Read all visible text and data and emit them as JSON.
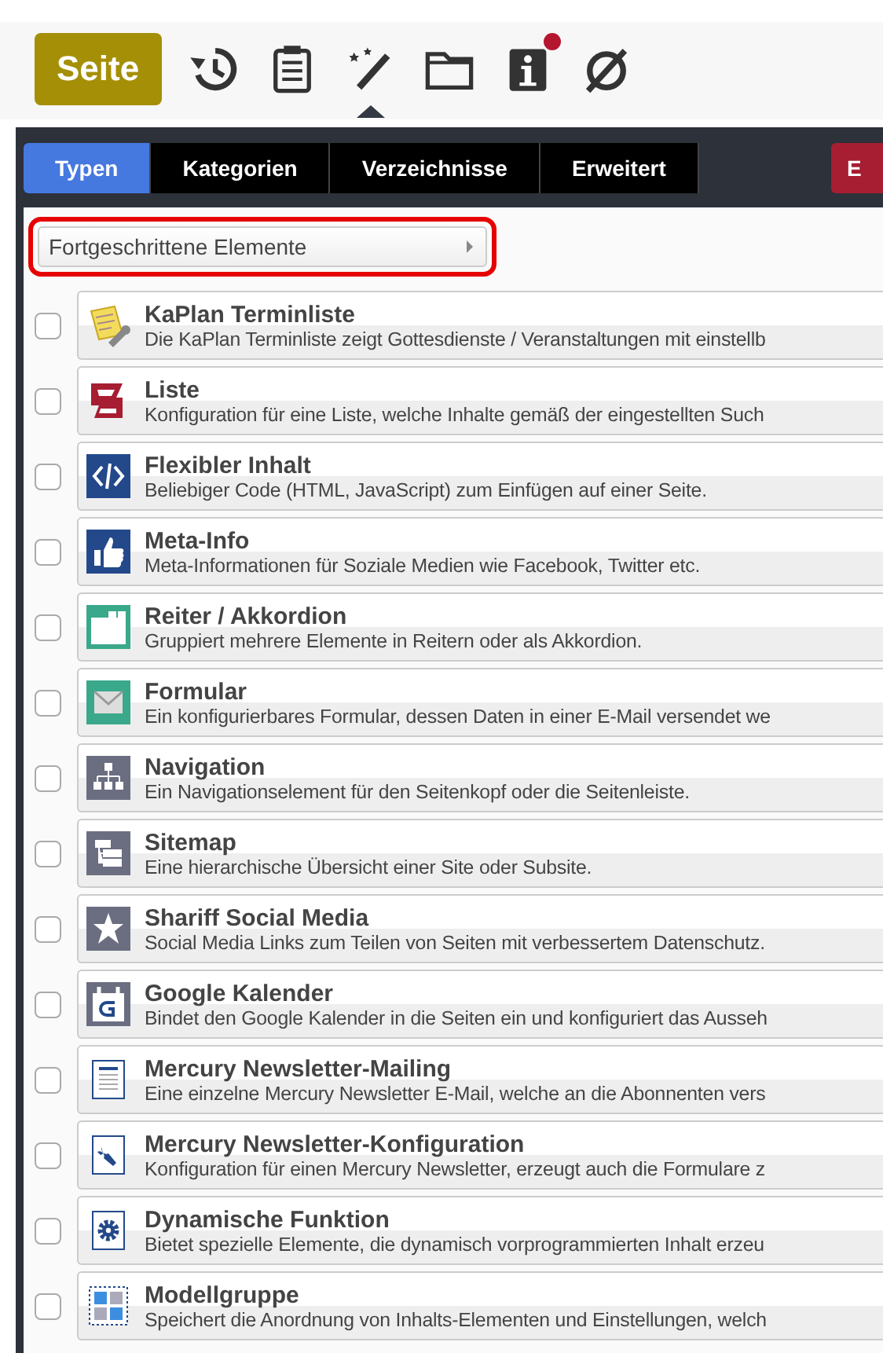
{
  "toolbar": {
    "page_button": "Seite",
    "icons": [
      {
        "selected": false,
        "badge": false
      },
      {
        "selected": false,
        "badge": false
      },
      {
        "selected": true,
        "badge": false
      },
      {
        "selected": false,
        "badge": false
      },
      {
        "selected": false,
        "badge": true
      },
      {
        "selected": false,
        "badge": false
      }
    ]
  },
  "tabs": [
    {
      "label": "Typen",
      "selected": true
    },
    {
      "label": "Kategorien",
      "selected": false
    },
    {
      "label": "Verzeichnisse",
      "selected": false
    },
    {
      "label": "Erweitert",
      "selected": false
    }
  ],
  "cut_button": "E",
  "dropdown": {
    "value": "Fortgeschrittene Elemente",
    "highlighted": true
  },
  "elements": [
    {
      "title": "KaPlan Terminliste",
      "description": "Die KaPlan Terminliste zeigt Gottesdienste / Veranstaltungen mit einstellb",
      "checked": false
    },
    {
      "title": "Liste",
      "description": "Konfiguration für eine Liste, welche Inhalte gemäß der eingestellten Such",
      "checked": false
    },
    {
      "title": "Flexibler Inhalt",
      "description": "Beliebiger Code (HTML, JavaScript) zum Einfügen auf einer Seite.",
      "checked": false
    },
    {
      "title": "Meta-Info",
      "description": "Meta-Informationen für Soziale Medien wie Facebook, Twitter etc.",
      "checked": false
    },
    {
      "title": "Reiter / Akkordion",
      "description": "Gruppiert mehrere Elemente in Reitern oder als Akkordion.",
      "checked": false
    },
    {
      "title": "Formular",
      "description": "Ein konfigurierbares Formular, dessen Daten in einer E-Mail versendet we",
      "checked": false
    },
    {
      "title": "Navigation",
      "description": "Ein Navigationselement für den Seitenkopf oder die Seitenleiste.",
      "checked": false
    },
    {
      "title": "Sitemap",
      "description": "Eine hierarchische Übersicht einer Site oder Subsite.",
      "checked": false
    },
    {
      "title": "Shariff Social Media",
      "description": "Social Media Links zum Teilen von Seiten mit verbessertem Datenschutz.",
      "checked": false
    },
    {
      "title": "Google Kalender",
      "description": "Bindet den Google Kalender in die Seiten ein und konfiguriert das Ausseh",
      "checked": false
    },
    {
      "title": "Mercury Newsletter-Mailing",
      "description": "Eine einzelne Mercury Newsletter E-Mail, welche an die Abonnenten vers",
      "checked": false
    },
    {
      "title": "Mercury Newsletter-Konfiguration",
      "description": "Konfiguration für einen Mercury Newsletter, erzeugt auch die Formulare z",
      "checked": false
    },
    {
      "title": "Dynamische Funktion",
      "description": "Bietet spezielle Elemente, die dynamisch vorprogrammierten Inhalt erzeu",
      "checked": false
    },
    {
      "title": "Modellgruppe",
      "description": "Speichert die Anordnung von Inhalts-Elementen und Einstellungen, welch",
      "checked": false
    }
  ]
}
